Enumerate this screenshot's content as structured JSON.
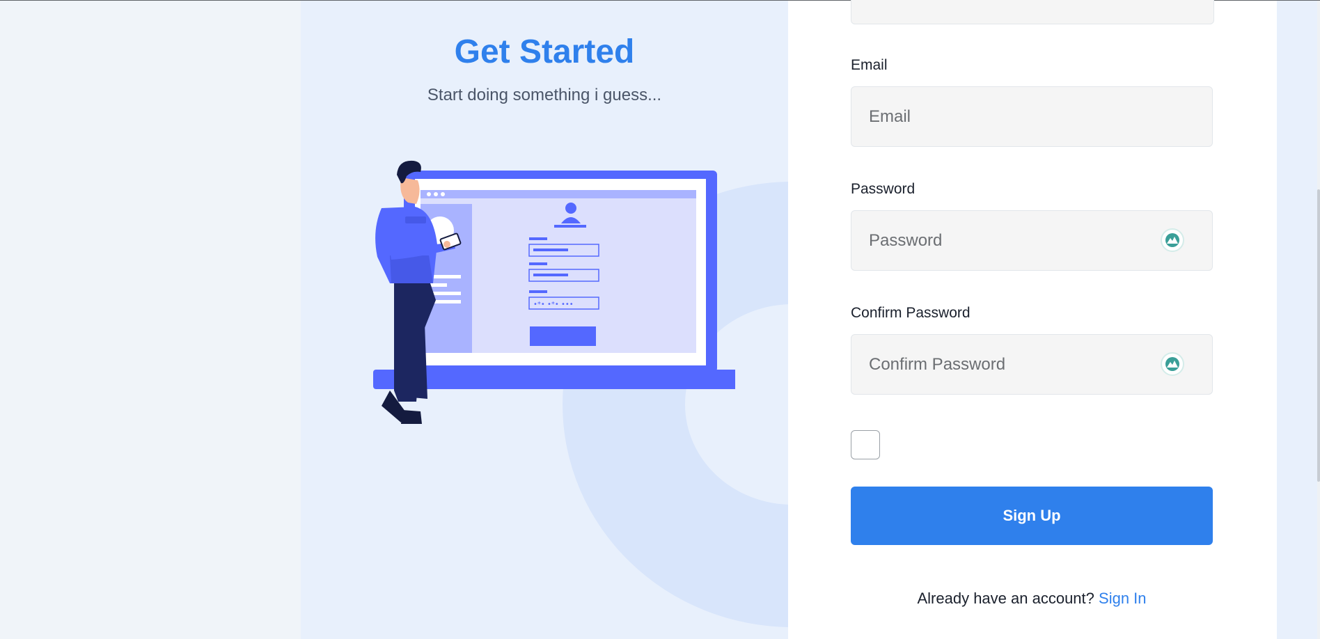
{
  "hero": {
    "title": "Get Started",
    "subtitle": "Start doing something i guess..."
  },
  "form": {
    "email": {
      "label": "Email",
      "placeholder": "Email",
      "value": ""
    },
    "password": {
      "label": "Password",
      "placeholder": "Password",
      "value": "",
      "toggle_icon": "password-manager-icon"
    },
    "confirm_password": {
      "label": "Confirm Password",
      "placeholder": "Confirm Password",
      "value": "",
      "toggle_icon": "password-manager-icon"
    },
    "terms_checkbox": {
      "checked": false
    },
    "submit_label": "Sign Up",
    "signin_prompt": "Already have an account?",
    "signin_link": "Sign In"
  },
  "colors": {
    "accent": "#2f80ec",
    "illustration_primary": "#5468ff",
    "left_panel_bg": "#e8f0fc"
  }
}
